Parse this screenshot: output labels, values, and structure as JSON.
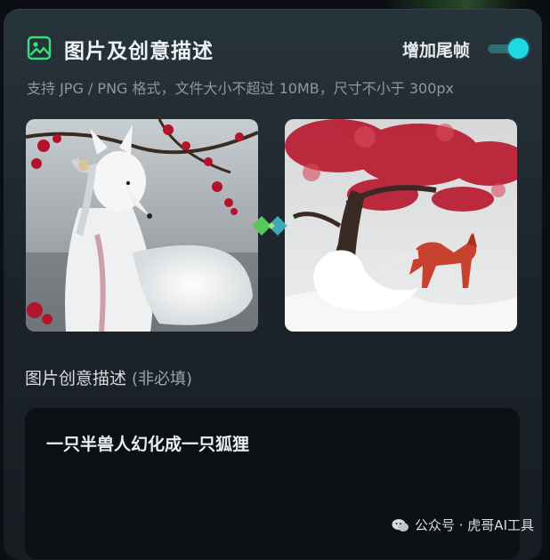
{
  "header": {
    "title": "图片及创意描述",
    "toggle_label": "增加尾帧",
    "toggle_on": true
  },
  "hint": "支持 JPG / PNG 格式，文件大小不超过 10MB，尺寸不小于 300px",
  "images": {
    "start_frame": "white-fox-girl-plum-blossom-image",
    "end_frame": "red-fox-under-plum-tree-snow-image"
  },
  "description": {
    "label": "图片创意描述",
    "optional": "(非必填)",
    "value": "一只半兽人幻化成一只狐狸"
  },
  "watermark": {
    "text": "公众号 · 虎哥AI工具"
  },
  "colors": {
    "accent": "#1fd8e6",
    "panel_bg": "#1d252c",
    "input_bg": "#0c0f13"
  }
}
